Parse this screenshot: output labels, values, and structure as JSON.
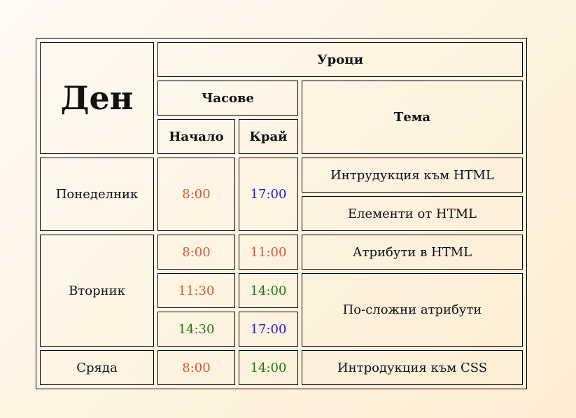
{
  "header": {
    "day": "Ден",
    "lessons": "Уроци",
    "hours": "Часове",
    "topic": "Тема",
    "start": "Начало",
    "end": "Край"
  },
  "colors": {
    "orange": "#e0572b",
    "blue": "#1f1fd9",
    "green": "#1c7a1c"
  },
  "rows": {
    "monday": {
      "day": "Понеделник",
      "start": "8:00",
      "end": "17:00",
      "topics": [
        "Интрудукция към HTML",
        "Елементи от HTML"
      ]
    },
    "tuesday": {
      "day": "Вторник",
      "slots": [
        {
          "start": "8:00",
          "end": "11:00"
        },
        {
          "start": "11:30",
          "end": "14:00"
        },
        {
          "start": "14:30",
          "end": "17:00"
        }
      ],
      "topics": [
        "Атрибути в HTML",
        "По-сложни атрибути"
      ]
    },
    "wednesday": {
      "day": "Сряда",
      "start": "8:00",
      "end": "14:00",
      "topic": "Интродукция към CSS"
    }
  }
}
